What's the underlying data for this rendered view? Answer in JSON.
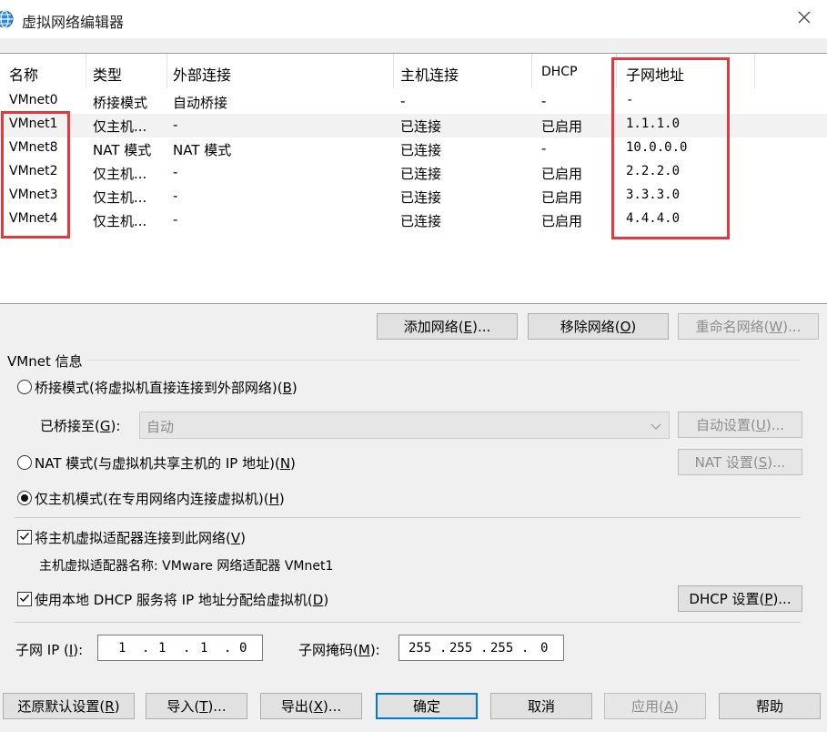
{
  "window": {
    "title": "虚拟网络编辑器",
    "icon": "globe-icon",
    "close_icon": "close-icon"
  },
  "table": {
    "headers": [
      "名称",
      "类型",
      "外部连接",
      "主机连接",
      "DHCP",
      "子网地址"
    ],
    "rows": [
      {
        "name": "VMnet0",
        "type": "桥接模式",
        "external": "自动桥接",
        "host": "-",
        "dhcp": "-",
        "subnet": "-"
      },
      {
        "name": "VMnet1",
        "type": "仅主机...",
        "external": "-",
        "host": "已连接",
        "dhcp": "已启用",
        "subnet": "1.1.1.0"
      },
      {
        "name": "VMnet8",
        "type": "NAT 模式",
        "external": "NAT 模式",
        "host": "已连接",
        "dhcp": "-",
        "subnet": "10.0.0.0"
      },
      {
        "name": "VMnet2",
        "type": "仅主机...",
        "external": "-",
        "host": "已连接",
        "dhcp": "已启用",
        "subnet": "2.2.2.0"
      },
      {
        "name": "VMnet3",
        "type": "仅主机...",
        "external": "-",
        "host": "已连接",
        "dhcp": "已启用",
        "subnet": "3.3.3.0"
      },
      {
        "name": "VMnet4",
        "type": "仅主机...",
        "external": "-",
        "host": "已连接",
        "dhcp": "已启用",
        "subnet": "4.4.4.0"
      }
    ],
    "selected_row": "VMnet1",
    "highlight_color": "#e0393e"
  },
  "list_buttons": {
    "add": {
      "text": "添加网络(",
      "key": "E",
      "suffix": ")..."
    },
    "remove": {
      "text": "移除网络(",
      "key": "O",
      "suffix": ")"
    },
    "rename": {
      "text": "重命名网络(",
      "key": "W",
      "suffix": ")..."
    }
  },
  "group": {
    "title": "VMnet 信息"
  },
  "options": {
    "bridged": {
      "text": "桥接模式(将虚拟机直接连接到外部网络)(",
      "key": "B",
      "suffix": ")",
      "selected": false
    },
    "bridged_to": {
      "text": "已桥接至(",
      "key": "G",
      "suffix": "):",
      "value": "自动"
    },
    "auto_settings": {
      "text": "自动设置(",
      "key": "U",
      "suffix": ")..."
    },
    "nat": {
      "text": "NAT 模式(与虚拟机共享主机的 IP 地址)(",
      "key": "N",
      "suffix": ")",
      "selected": false
    },
    "nat_settings": {
      "text": "NAT 设置(",
      "key": "S",
      "suffix": ")..."
    },
    "hostonly": {
      "text": "仅主机模式(在专用网络内连接虚拟机)(",
      "key": "H",
      "suffix": ")",
      "selected": true
    },
    "connect_adapter": {
      "text": "将主机虚拟适配器连接到此网络(",
      "key": "V",
      "suffix": ")",
      "checked": true
    },
    "adapter_name": "主机虚拟适配器名称: VMware 网络适配器 VMnet1",
    "use_dhcp": {
      "text": "使用本地 DHCP 服务将 IP 地址分配给虚拟机(",
      "key": "D",
      "suffix": ")",
      "checked": true
    },
    "dhcp_settings": {
      "text": "DHCP 设置(",
      "key": "P",
      "suffix": ")..."
    }
  },
  "subnet": {
    "ip_label": {
      "text": "子网 IP (",
      "key": "I",
      "suffix": "):"
    },
    "ip": [
      "1",
      "1",
      "1",
      "0"
    ],
    "mask_label": {
      "text": "子网掩码(",
      "key": "M",
      "suffix": "):"
    },
    "mask": [
      "255",
      "255",
      "255",
      "0"
    ]
  },
  "footer": {
    "restore": {
      "text": "还原默认设置(",
      "key": "R",
      "suffix": ")"
    },
    "import": {
      "text": "导入(",
      "key": "T",
      "suffix": ")..."
    },
    "export": {
      "text": "导出(",
      "key": "X",
      "suffix": ")..."
    },
    "ok": "确定",
    "cancel": "取消",
    "apply": {
      "text": "应用(",
      "key": "A",
      "suffix": ")"
    },
    "help": "帮助"
  }
}
